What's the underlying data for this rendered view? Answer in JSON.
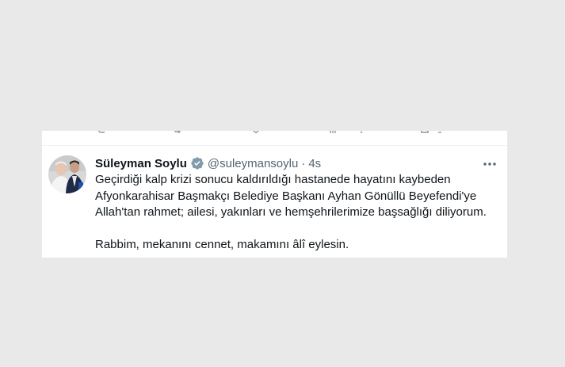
{
  "tweet": {
    "author_name": "Süleyman Soylu",
    "handle": "@suleymansoylu",
    "separator": "·",
    "time": "4s",
    "verified_icon": "verified-badge-icon",
    "more_icon": "more-horizontal-icon",
    "body_lines": [
      "Geçirdiği kalp krizi sonucu kaldırıldığı hastanede hayatını kaybeden",
      "Afyonkarahisar Başmakçı Belediye Başkanı Ayhan Gönüllü Beyefendi'ye",
      "Allah'tan rahmet; ailesi, yakınları ve hemşehrilerimize başsağlığı diliyorum."
    ],
    "body_second_paragraph": "Rabbim, mekanını cennet, makamını âlî eylesin."
  },
  "colors": {
    "background": "#e9e9e9",
    "card": "#ffffff",
    "text_primary": "#0f1419",
    "text_secondary": "#536471",
    "verified": "#829aab"
  }
}
